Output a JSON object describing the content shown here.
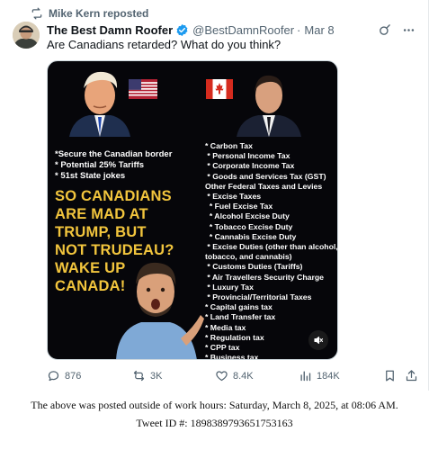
{
  "repost": {
    "text": "Mike Kern reposted"
  },
  "author": {
    "display_name": "The Best Damn Roofer",
    "handle": "@BestDamnRoofer",
    "separator": "·",
    "date": "Mar 8"
  },
  "tweet": {
    "text": "Are Canadians retarded? What do you think?"
  },
  "media": {
    "left_bullets": "*Secure the Canadian border\n* Potential 25% Tariffs\n* 51st State jokes",
    "headline_lines": [
      "SO CANADIANS",
      "ARE MAD AT",
      "TRUMP, BUT",
      "NOT TRUDEAU?",
      "WAKE UP",
      "CANADA!"
    ],
    "tax_list": "* Carbon Tax\n * Personal Income Tax\n * Corporate Income Tax\n * Goods and Services Tax (GST)\nOther Federal Taxes and Levies\n * Excise Taxes\n  * Fuel Excise Tax\n  * Alcohol Excise Duty\n  * Tobacco Excise Duty\n  * Cannabis Excise Duty\n * Excise Duties (other than alcohol,\ntobacco, and cannabis)\n * Customs Duties (Tariffs)\n * Air Travellers Security Charge\n * Luxury Tax\n * Provincial/Territorial Taxes\n* Capital gains tax\n* Land Transfer tax\n* Media tax\n* Regulation tax\n* CPP tax\n* Business tax",
    "icons": [
      "us-flag-icon",
      "canada-flag-icon",
      "mute-icon"
    ]
  },
  "actions": {
    "replies": "876",
    "reposts": "3K",
    "likes": "8.4K",
    "views": "184K"
  },
  "footer": {
    "line1": "The above was posted outside of work hours: Saturday, March 8, 2025, at 08:06 AM.",
    "line2": "Tweet ID #: 1898389793651753163"
  },
  "colors": {
    "accent": "#1d9bf0",
    "muted": "#536471",
    "headline": "#f2c53d"
  }
}
